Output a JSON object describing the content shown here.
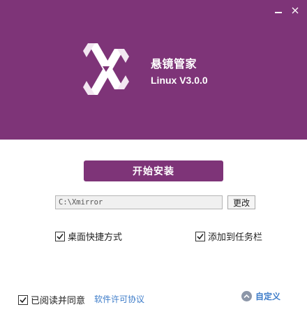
{
  "header": {
    "app_name": "悬镜管家",
    "version": "Linux V3.0.0",
    "background_color": "#7e3478",
    "logo_icon": "x-ribbon-logo",
    "window_controls": [
      "minimize-icon",
      "close-icon"
    ]
  },
  "install": {
    "button_label": "开始安装",
    "path_value": "C:\\Xmirror",
    "change_label": "更改"
  },
  "options": {
    "desktop_shortcut": {
      "label": "桌面快捷方式",
      "checked": true
    },
    "taskbar_pin": {
      "label": "添加到任务栏",
      "checked": true
    }
  },
  "footer": {
    "agree_label": "已阅读并同意",
    "agree_checked": true,
    "license_link": "软件许可协议",
    "custom_label": "自定义",
    "custom_icon": "chevron-up-circle-icon",
    "link_color": "#3d7cc9"
  }
}
